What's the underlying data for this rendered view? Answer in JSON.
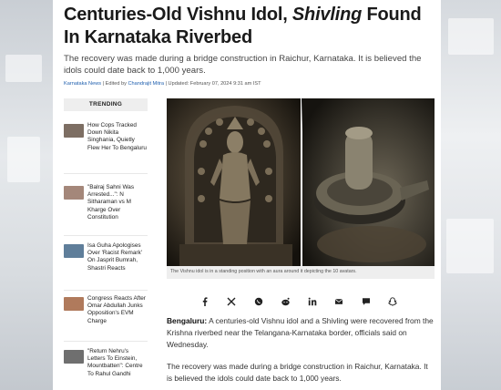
{
  "article": {
    "headline_part1": "Centuries-Old Vishnu Idol, ",
    "headline_italic": "Shivling",
    "headline_part2": " Found In Karnataka Riverbed",
    "summary": "The recovery was made during a bridge construction in Raichur, Karnataka. It is believed the idols could date back to 1,000 years.",
    "byline": {
      "source": "Karnataka News",
      "edited_prefix": " | Edited by ",
      "editor": "Chandrajit Mitra",
      "updated": " | Updated: February 07, 2024 9:31 am IST"
    },
    "image_caption": "The Vishnu idol is in a standing position with an aura around it depicting the 10 avatars.",
    "body_lead": "Bengaluru:",
    "body_p1": " A centuries-old Vishnu idol and a Shivling were recovered from the Krishna riverbed near the Telangana-Karnataka border, officials said on Wednesday.",
    "body_p2": "The recovery was made during a bridge construction in Raichur, Karnataka. It is believed the idols could date back to 1,000 years."
  },
  "trending": {
    "heading": "TRENDING",
    "items": [
      {
        "text": "How Cops Tracked Down Nikita Singhania, Quietly Flew Her To Bengaluru"
      },
      {
        "text": "\"Balraj Sahni Was Arrested...\": N Sitharaman vs M Kharge Over Constitution"
      },
      {
        "text": "Isa Guha Apologises Over 'Racist Remark' On Jasprit Bumrah, Shastri Reacts"
      },
      {
        "text": "Congress Reacts After Omar Abdullah Junks Opposition's EVM Charge"
      },
      {
        "text": "\"Return Nehru's Letters To Einstein, Mountbatten\": Centre To Rahul Gandhi"
      }
    ]
  },
  "share_icons": [
    "facebook-icon",
    "x-icon",
    "whatsapp-icon",
    "reddit-icon",
    "linkedin-icon",
    "email-icon",
    "comment-icon",
    "snapchat-icon"
  ],
  "colors": {
    "link": "#1f5fae",
    "headline": "#1a1a1a",
    "caption_bg": "#eeeeee"
  }
}
